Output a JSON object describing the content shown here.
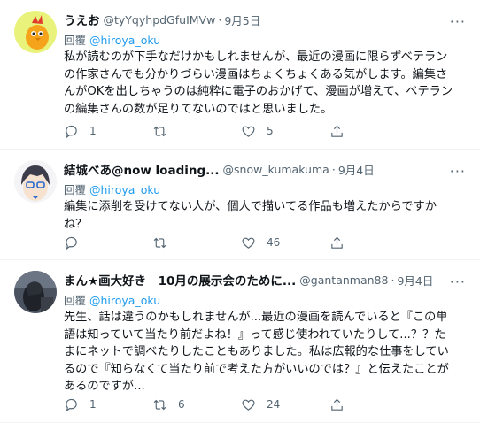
{
  "tweets": [
    {
      "name": "うえお",
      "handle": "@tyYqyhpdGfuIMVw",
      "date": "9月5日",
      "reply_prefix": "回覆 ",
      "reply_to": "@hiroya_oku",
      "text": "私が読むのが下手なだけかもしれませんが、最近の漫画に限らずベテラン\nの作家さんでも分かりづらい漫画はちょくちょくある気がします。編集さ\nんがOKを出しちゃうのは純粋に電子のおかげて、漫画が増えて、ベテラン\nの編集さんの数が足りてないのではと思いました。",
      "replies": "1",
      "retweets": "",
      "likes": "5"
    },
    {
      "name": "結城べあ@now loading...",
      "handle": "@snow_kumakuma",
      "date": "9月4日",
      "reply_prefix": "回覆 ",
      "reply_to": "@hiroya_oku",
      "text": "編集に添削を受けてない人が、個人で描いてる作品も増えたからですか\nね？",
      "replies": "",
      "retweets": "",
      "likes": "46"
    },
    {
      "name": "まん★画大好き　10月の展示会のために...",
      "handle": "@gantanman88",
      "date": "9月4日",
      "reply_prefix": "回覆 ",
      "reply_to": "@hiroya_oku",
      "text": "先生、話は違うのかもしれませんが...最近の漫画を読んでいると『この単\n語は知っていて当たり前だよね！』って感じ使われていたりして...？？た\nまにネットで調べたりしたこともありました。私は広報的な仕事をしてい\nるので『知らなくて当たり前で考えた方がいいのでは？』と伝えたことが\nあるのですが...",
      "replies": "1",
      "retweets": "6",
      "likes": "24"
    }
  ],
  "more_glyph": "···",
  "colors": {
    "link": "#1d9bf0",
    "secondary": "#536471",
    "text": "#0f1419",
    "divider": "#eff3f4"
  },
  "icons": [
    "reply-icon",
    "retweet-icon",
    "like-icon",
    "share-icon",
    "more-icon"
  ]
}
